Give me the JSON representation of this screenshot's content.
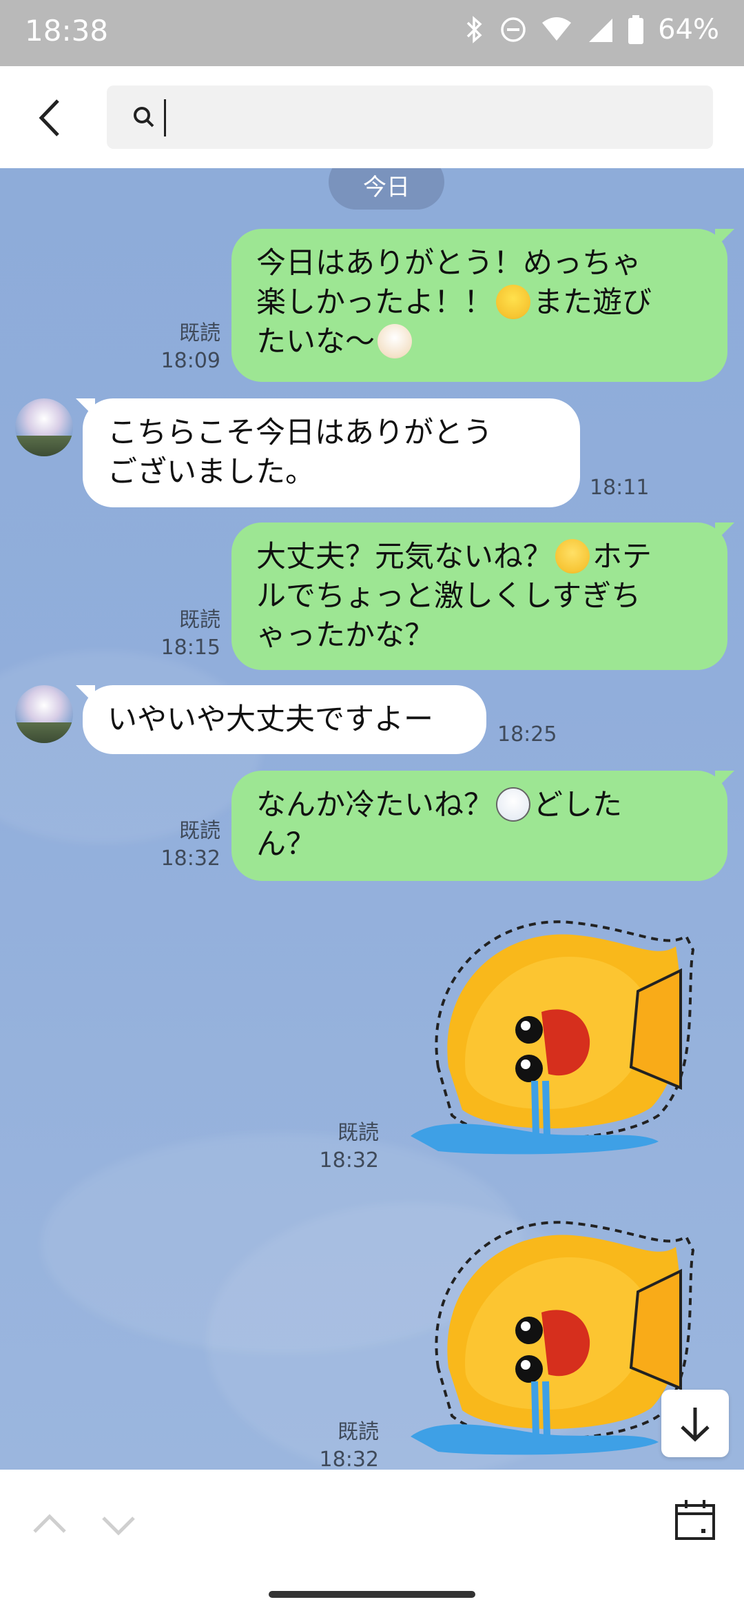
{
  "status_bar": {
    "time": "18:38",
    "battery": "64%"
  },
  "search": {
    "placeholder": ""
  },
  "chat": {
    "date_chip": "今日",
    "messages": [
      {
        "dir": "out",
        "parts": [
          "今日はありがとう！めっちゃ",
          "楽しかったよ！！",
          "また遊び",
          "たいな〜"
        ],
        "read": "既読",
        "time": "18:09"
      },
      {
        "dir": "in",
        "lines": [
          "こちらこそ今日はありがとう",
          "ございました。"
        ],
        "time": "18:11"
      },
      {
        "dir": "out",
        "parts": [
          "大丈夫？元気ないね？",
          "ホテ",
          "ルでちょっと激しくしすぎち",
          "ゃったかな？"
        ],
        "read": "既読",
        "time": "18:15"
      },
      {
        "dir": "in",
        "lines": [
          "いやいや大丈夫ですよー"
        ],
        "time": "18:25"
      },
      {
        "dir": "out",
        "parts": [
          "なんか冷たいね？",
          "どした",
          "ん？"
        ],
        "read": "既読",
        "time": "18:32"
      },
      {
        "dir": "out",
        "type": "sticker",
        "read": "既読",
        "time": "18:32"
      },
      {
        "dir": "out",
        "type": "sticker",
        "read": "既読",
        "time": "18:32"
      }
    ]
  },
  "icons": {
    "back": "chevron-left-icon",
    "search": "search-icon",
    "scroll_down": "arrow-down-icon",
    "prev": "chevron-up-icon",
    "next": "chevron-down-icon",
    "calendar": "calendar-icon"
  },
  "colors": {
    "outgoing_bubble": "#9de693",
    "incoming_bubble": "#ffffff",
    "chat_bg": "#8eacd9"
  }
}
